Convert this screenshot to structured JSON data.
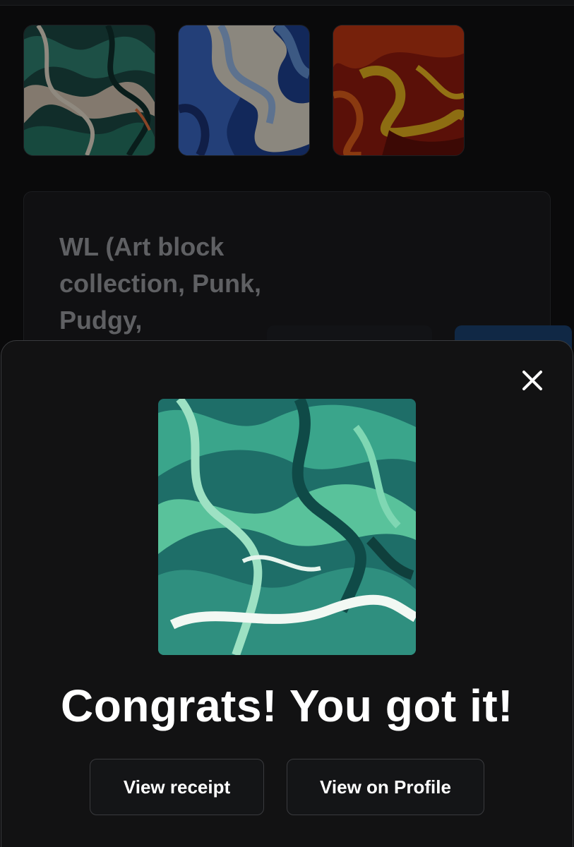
{
  "thumbnails": [
    {
      "icon": "marble-teal-artwork",
      "colors": [
        "#1a4a45",
        "#2f7f70",
        "#c7b8a8"
      ]
    },
    {
      "icon": "marble-blue-artwork",
      "colors": [
        "#1d3f8a",
        "#5c89c9",
        "#d8d2c5"
      ]
    },
    {
      "icon": "marble-red-artwork",
      "colors": [
        "#8a1b0e",
        "#d04a12",
        "#e2b01f"
      ]
    }
  ],
  "background_card": {
    "text": "WL (Art block collection, Punk, Pudgy,"
  },
  "modal": {
    "close_icon": "close-icon",
    "artwork_icon": "marble-green-artwork",
    "title": "Congrats! You got it!",
    "buttons": {
      "receipt": "View receipt",
      "profile": "View on Profile"
    }
  },
  "colors": {
    "modal_background": "#121213",
    "button_border": "#3a3b3e",
    "text_primary": "#ffffff"
  }
}
